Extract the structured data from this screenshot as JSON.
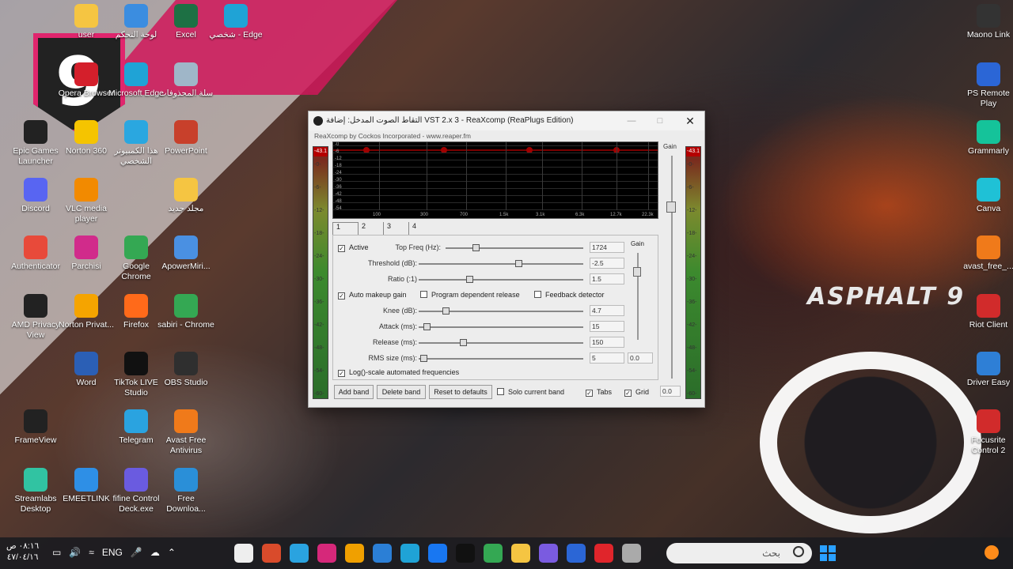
{
  "desktop_icons": [
    {
      "label": "user",
      "icon": "folder-icon",
      "color": "#f5c542"
    },
    {
      "label": "لوحة التحكم",
      "icon": "control-panel-icon",
      "color": "#3b8de0"
    },
    {
      "label": "Excel",
      "icon": "excel-icon",
      "color": "#1d7044"
    },
    {
      "label": "شخصي - Edge",
      "icon": "edge-icon",
      "color": "#1fa3d6"
    },
    {
      "label": "Opera Browser",
      "icon": "opera-icon",
      "color": "#d41f2b"
    },
    {
      "label": "Microsoft Edge",
      "icon": "edge-icon",
      "color": "#1fa3d6"
    },
    {
      "label": "سلة المحذوفات",
      "icon": "recycle-bin-icon",
      "color": "#9fb6c8"
    },
    {
      "label": "Epic Games Launcher",
      "icon": "epic-games-icon",
      "color": "#222222"
    },
    {
      "label": "Norton 360",
      "icon": "norton-icon",
      "color": "#f5c400"
    },
    {
      "label": "هذا الكمبيوتر الشخصي",
      "icon": "computer-icon",
      "color": "#2aa7e0"
    },
    {
      "label": "PowerPoint",
      "icon": "powerpoint-icon",
      "color": "#c8402b"
    },
    {
      "label": "Discord",
      "icon": "discord-icon",
      "color": "#5865f2"
    },
    {
      "label": "VLC media player",
      "icon": "vlc-icon",
      "color": "#f28a00"
    },
    {
      "label": "مجلد جديد",
      "icon": "folder-icon",
      "color": "#f5c542"
    },
    {
      "label": "Authenticator",
      "icon": "authenticator-icon",
      "color": "#e84a3a"
    },
    {
      "label": "Parchisi",
      "icon": "parchisi-icon",
      "color": "#d12b8b"
    },
    {
      "label": "Google Chrome",
      "icon": "chrome-icon",
      "color": "#34a853"
    },
    {
      "label": "ApowerMiri...",
      "icon": "apowermirror-icon",
      "color": "#4a90e2"
    },
    {
      "label": "AMD Privacy View",
      "icon": "amd-privacy-icon",
      "color": "#222222"
    },
    {
      "label": "Norton Privat...",
      "icon": "norton-private-icon",
      "color": "#f5a400"
    },
    {
      "label": "Firefox",
      "icon": "firefox-icon",
      "color": "#ff6a1a"
    },
    {
      "label": "sabiri - Chrome",
      "icon": "chrome-icon",
      "color": "#34a853"
    },
    {
      "label": "Word",
      "icon": "word-icon",
      "color": "#2b5fb5"
    },
    {
      "label": "TikTok LIVE Studio",
      "icon": "tiktok-icon",
      "color": "#111111"
    },
    {
      "label": "OBS Studio",
      "icon": "obs-icon",
      "color": "#2f2f2f"
    },
    {
      "label": "FrameView",
      "icon": "frameview-icon",
      "color": "#222222"
    },
    {
      "label": "Telegram",
      "icon": "telegram-icon",
      "color": "#2aa3e0"
    },
    {
      "label": "Avast Free Antivirus",
      "icon": "avast-icon",
      "color": "#f07a1a"
    },
    {
      "label": "Streamlabs Desktop",
      "icon": "streamlabs-icon",
      "color": "#31c3a2"
    },
    {
      "label": "EMEETLINK",
      "icon": "emeetlink-icon",
      "color": "#2e8fe6"
    },
    {
      "label": "fifine Control Deck.exe",
      "icon": "fifine-icon",
      "color": "#6a5be0"
    },
    {
      "label": "Free Downloa...",
      "icon": "free-download-icon",
      "color": "#2a8fd8"
    },
    {
      "label": "Maono Link",
      "icon": "maono-icon",
      "color": "#333333"
    },
    {
      "label": "PS Remote Play",
      "icon": "ps-remote-icon",
      "color": "#2b66d6"
    },
    {
      "label": "Grammarly",
      "icon": "grammarly-icon",
      "color": "#15c39a"
    },
    {
      "label": "Canva",
      "icon": "canva-icon",
      "color": "#1fc1d6"
    },
    {
      "label": "avast_free_...",
      "icon": "avast-icon",
      "color": "#f07a1a"
    },
    {
      "label": "Riot Client",
      "icon": "riot-icon",
      "color": "#d12b2b"
    },
    {
      "label": "Driver Easy",
      "icon": "driver-easy-icon",
      "color": "#2e7fd6"
    },
    {
      "label": "Focusrite Control 2",
      "icon": "focusrite-icon",
      "color": "#d12b2b"
    }
  ],
  "window": {
    "title": "التقاط الصوت المدخل: إضافة VST 2.x 3 - ReaXcomp (ReaPlugs Edition)",
    "subtitle": "ReaXcomp by Cockos Incorporated - www.reaper.fm",
    "left_meter_peak": "-43.1",
    "right_meter_peak": "-43.1",
    "meter_scale": [
      "-0-",
      "-6-",
      "-12-",
      "-18-",
      "-24-",
      "-30-",
      "-36-",
      "-42-",
      "-48-",
      "-54-",
      "-60-"
    ],
    "gain_label": "Gain",
    "graph_db_labels": [
      "-0",
      "-6",
      "-12",
      "-18",
      "-24",
      "-30",
      "-36",
      "-42",
      "-48",
      "-54"
    ],
    "graph_freq_labels": [
      "100",
      "300",
      "700",
      "1.5k",
      "3.1k",
      "6.3k",
      "12.7k",
      "22.3k"
    ],
    "tabs": [
      "1",
      "2",
      "3",
      "4"
    ],
    "active_label": "Active",
    "top_freq": {
      "label": "Top Freq (Hz):",
      "value": "1724"
    },
    "threshold": {
      "label": "Threshold (dB):",
      "value": "-2.5"
    },
    "ratio": {
      "label": "Ratio (:1)",
      "value": "1.5"
    },
    "auto_makeup_label": "Auto makeup gain",
    "program_dependent_label": "Program dependent release",
    "feedback_detector_label": "Feedback detector",
    "knee": {
      "label": "Knee (dB):",
      "value": "4.7"
    },
    "attack": {
      "label": "Attack (ms):",
      "value": "15"
    },
    "release": {
      "label": "Release (ms):",
      "value": "150"
    },
    "rms": {
      "label": "RMS size (ms):",
      "value": "5"
    },
    "panel_gain_label": "Gain",
    "panel_gain_value": "0.0",
    "log_scale_label": "Log()-scale automated frequencies",
    "buttons": {
      "add_band": "Add band",
      "delete_band": "Delete band",
      "reset": "Reset to defaults"
    },
    "solo_label": "Solo current band",
    "tabs_label": "Tabs",
    "grid_label": "Grid",
    "output_gain_value": "0.0"
  },
  "taskbar": {
    "time": "٠٨:١٦ ص",
    "date": "٤٧/٠٤/١٦",
    "lang": "ENG",
    "search_placeholder": "بحث"
  }
}
